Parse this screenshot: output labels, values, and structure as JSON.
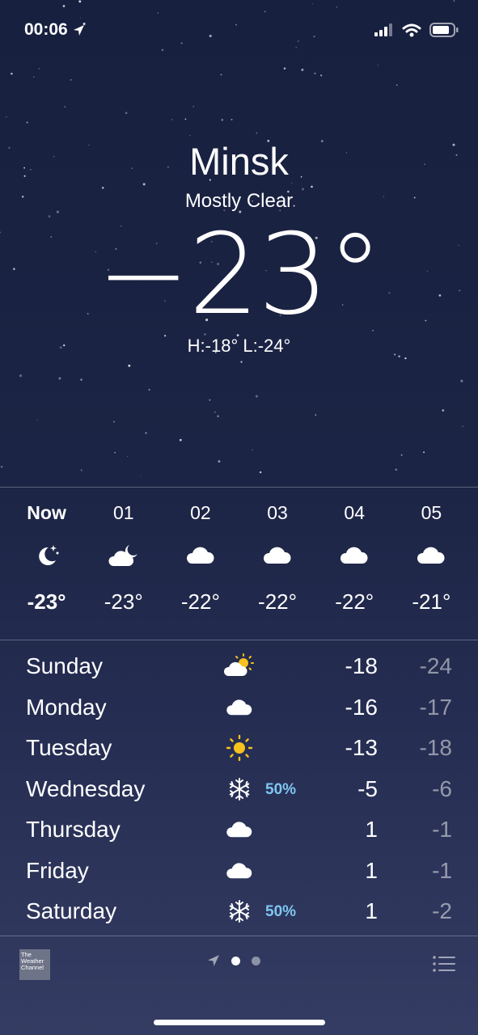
{
  "status": {
    "time": "00:06",
    "icons": [
      "location-arrow-icon",
      "signal-bars-icon",
      "wifi-icon",
      "battery-icon"
    ]
  },
  "hero": {
    "city": "Minsk",
    "condition": "Mostly Clear",
    "temperature": "−23°",
    "hilo": "H:-18°  L:-24°"
  },
  "hourly": [
    {
      "label": "Now",
      "icon": "moon-stars-icon",
      "temp": "-23°"
    },
    {
      "label": "01",
      "icon": "cloud-moon-icon",
      "temp": "-23°"
    },
    {
      "label": "02",
      "icon": "cloud-icon",
      "temp": "-22°"
    },
    {
      "label": "03",
      "icon": "cloud-icon",
      "temp": "-22°"
    },
    {
      "label": "04",
      "icon": "cloud-icon",
      "temp": "-22°"
    },
    {
      "label": "05",
      "icon": "cloud-icon",
      "temp": "-21°"
    }
  ],
  "daily": [
    {
      "day": "Sunday",
      "icon": "partly-sunny-icon",
      "precip": "",
      "high": "-18",
      "low": "-24"
    },
    {
      "day": "Monday",
      "icon": "cloud-icon",
      "precip": "",
      "high": "-16",
      "low": "-17"
    },
    {
      "day": "Tuesday",
      "icon": "sun-icon",
      "precip": "",
      "high": "-13",
      "low": "-18"
    },
    {
      "day": "Wednesday",
      "icon": "snowflake-icon",
      "precip": "50%",
      "high": "-5",
      "low": "-6"
    },
    {
      "day": "Thursday",
      "icon": "cloud-icon",
      "precip": "",
      "high": "1",
      "low": "-1"
    },
    {
      "day": "Friday",
      "icon": "cloud-icon",
      "precip": "",
      "high": "1",
      "low": "-1"
    },
    {
      "day": "Saturday",
      "icon": "snowflake-icon",
      "precip": "50%",
      "high": "1",
      "low": "-2"
    }
  ],
  "footer": {
    "logo_text": "The Weather Channel",
    "page_count": 2,
    "active_page": 0
  },
  "colors": {
    "precip": "#7fc6f0",
    "sun": "#f7c21c"
  }
}
